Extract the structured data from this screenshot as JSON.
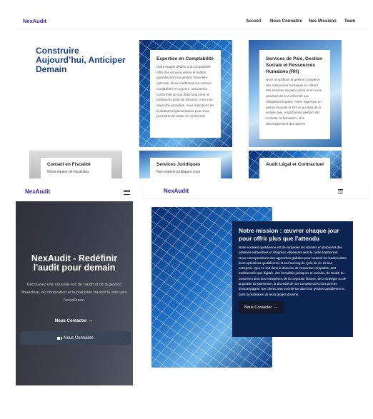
{
  "desktop": {
    "logo": "NexAudit",
    "nav": [
      "Accueil",
      "Nous Connaitre",
      "Nos Missions",
      "Team"
    ],
    "headline": "Construire Aujourd’hui, Anticiper Demain",
    "cards": [
      {
        "title": "Expertise en Comptabilité",
        "text": "Notre équipe dédiée à la comptabilité offre des services précis et fiables, garantissant une gestion financière optimale. Nous maîtrisons les normes comptables en vigueur, assurant la conformité de vos états financiers et facilitant la prise de décision. Avec une approche proactive, nous anticipons les évolutions réglementaires pour vous permettre de rester en conformité."
      },
      {
        "title": "Services de Paie, Gestion Sociale et Ressources Humaines (RH)",
        "text": "Nous simplifions la gestion complexe des ressources humaines en offrant des services de paie précis et en vous assurant de la conformité aux obligations légales. Notre expertise en gestion sociale et RH va au-delà de la simple paie, englobant la gestion des contrats, la formation, et le développement des talents"
      },
      {
        "title": "Conseil en Fiscalité",
        "text": "Notre équipe de fiscalistes"
      },
      {
        "title": "Services Juridiques",
        "text": "Nos experts juridiques vous"
      },
      {
        "title": "Audit Légal et Contractuel",
        "text": ""
      }
    ]
  },
  "mobile_hero": {
    "logo": "NexAudit",
    "menu_icon": "hamburger-icon",
    "title": "NexAudit - Redéfinir l'audit pour demain",
    "subtitle": "Découvrez une nouvelle ère de l'audit et de la gestion financière, où l'innovation et la précision tracent la voie vers l'excellence.",
    "contact_label": "Nous Contacter",
    "know_label": "Nous Connaitre"
  },
  "mission": {
    "logo": "NexAudit",
    "menu_icon": "hamburger-icon",
    "title": "Notre mission : œuvrer chaque jour pour offrir plus que l'attendu",
    "text": "Notre vocation quotidienne est de surpasser les attentes en proposant des solutions exhaustives et intégrées, dépassant ainsi le cadre traditionnel. Nous conceptualisons des approches globales pour soutenir les leaders dans leurs opérations quotidiennes et tout au long du cycle de vie de leur entreprise. Que ce soit dans le domaine de l'expertise comptable, tant traditionnelle que digitale, des formalités juridiques et sociales, de l'audit, du conseil en droit des entreprises, de la corporate finance, de la stratégie ou de la gestion de patrimoine, la diversité de nos compétences nous permet d'accompagner nos clients avec excellence dans leur gestion quotidienne et dans la réalisation de leurs projets d'avenir.",
    "contact_label": "Nous Contacter"
  },
  "colors": {
    "brand": "#3a1fa8",
    "headline": "#1a3f8a",
    "mission_bg": "#0b2350",
    "button_dark": "#161a2a"
  }
}
